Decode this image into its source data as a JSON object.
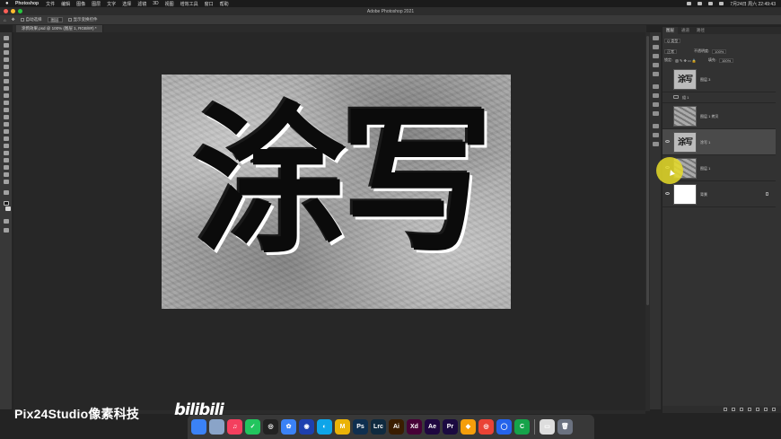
{
  "menubar": {
    "app": "Photoshop",
    "items": [
      "文件",
      "编辑",
      "图像",
      "图层",
      "文字",
      "选择",
      "滤镜",
      "3D",
      "视图",
      "增效工具",
      "窗口",
      "帮助"
    ],
    "clock": "7月24日 周六 22:49:43"
  },
  "window": {
    "title": "Adobe Photoshop 2021"
  },
  "options": {
    "auto_select": "自动选择",
    "group": "图层",
    "show_transform": "显示变换控件"
  },
  "document": {
    "tab": "涂鸦效果.psd @ 100% (图层 1, RGB/8#) *",
    "text": "涂写"
  },
  "panel": {
    "tabs": [
      "图层",
      "通道",
      "路径"
    ],
    "kind": "Q 类型",
    "blend": "正常",
    "opacity_label": "不透明度:",
    "opacity": "100%",
    "lock_label": "锁定:",
    "fill_label": "填充:",
    "fill": "100%",
    "layers": [
      {
        "name": "图层 3",
        "thumb": "text-tex"
      },
      {
        "name": "组 1",
        "thumb": "folder"
      },
      {
        "name": "图层 1 拷贝",
        "thumb": "tex"
      },
      {
        "name": "涂写 1",
        "thumb": "text"
      },
      {
        "name": "图层 1",
        "thumb": "tex"
      },
      {
        "name": "背景",
        "thumb": "white"
      }
    ]
  },
  "watermark": {
    "text": "Pix24Studio像素科技",
    "logo": "bilibili"
  },
  "dock": {
    "apps": [
      {
        "label": "",
        "color": "#3b82f6"
      },
      {
        "label": "",
        "color": "#8aa4c8"
      },
      {
        "label": "♫",
        "color": "#f43f5e"
      },
      {
        "label": "✓",
        "color": "#22c55e"
      },
      {
        "label": "◎",
        "color": "#222222"
      },
      {
        "label": "✿",
        "color": "#3b82f6"
      },
      {
        "label": "◉",
        "color": "#1e40af"
      },
      {
        "label": "◐",
        "color": "#0ea5e9"
      },
      {
        "label": "M",
        "color": "#eab308"
      },
      {
        "label": "Ps",
        "color": "#0f2f4f"
      },
      {
        "label": "Lrc",
        "color": "#0f2a3f"
      },
      {
        "label": "Ai",
        "color": "#3a1d00"
      },
      {
        "label": "Xd",
        "color": "#470137"
      },
      {
        "label": "Ae",
        "color": "#1f0740"
      },
      {
        "label": "Pr",
        "color": "#1b0a40"
      },
      {
        "label": "◆",
        "color": "#f59e0b"
      },
      {
        "label": "◎",
        "color": "#ea4335"
      },
      {
        "label": "◯",
        "color": "#2563eb"
      },
      {
        "label": "C",
        "color": "#16a34a"
      },
      {
        "label": "▭",
        "color": "#dddddd"
      },
      {
        "label": "🗑",
        "color": "#6b7280"
      }
    ]
  }
}
